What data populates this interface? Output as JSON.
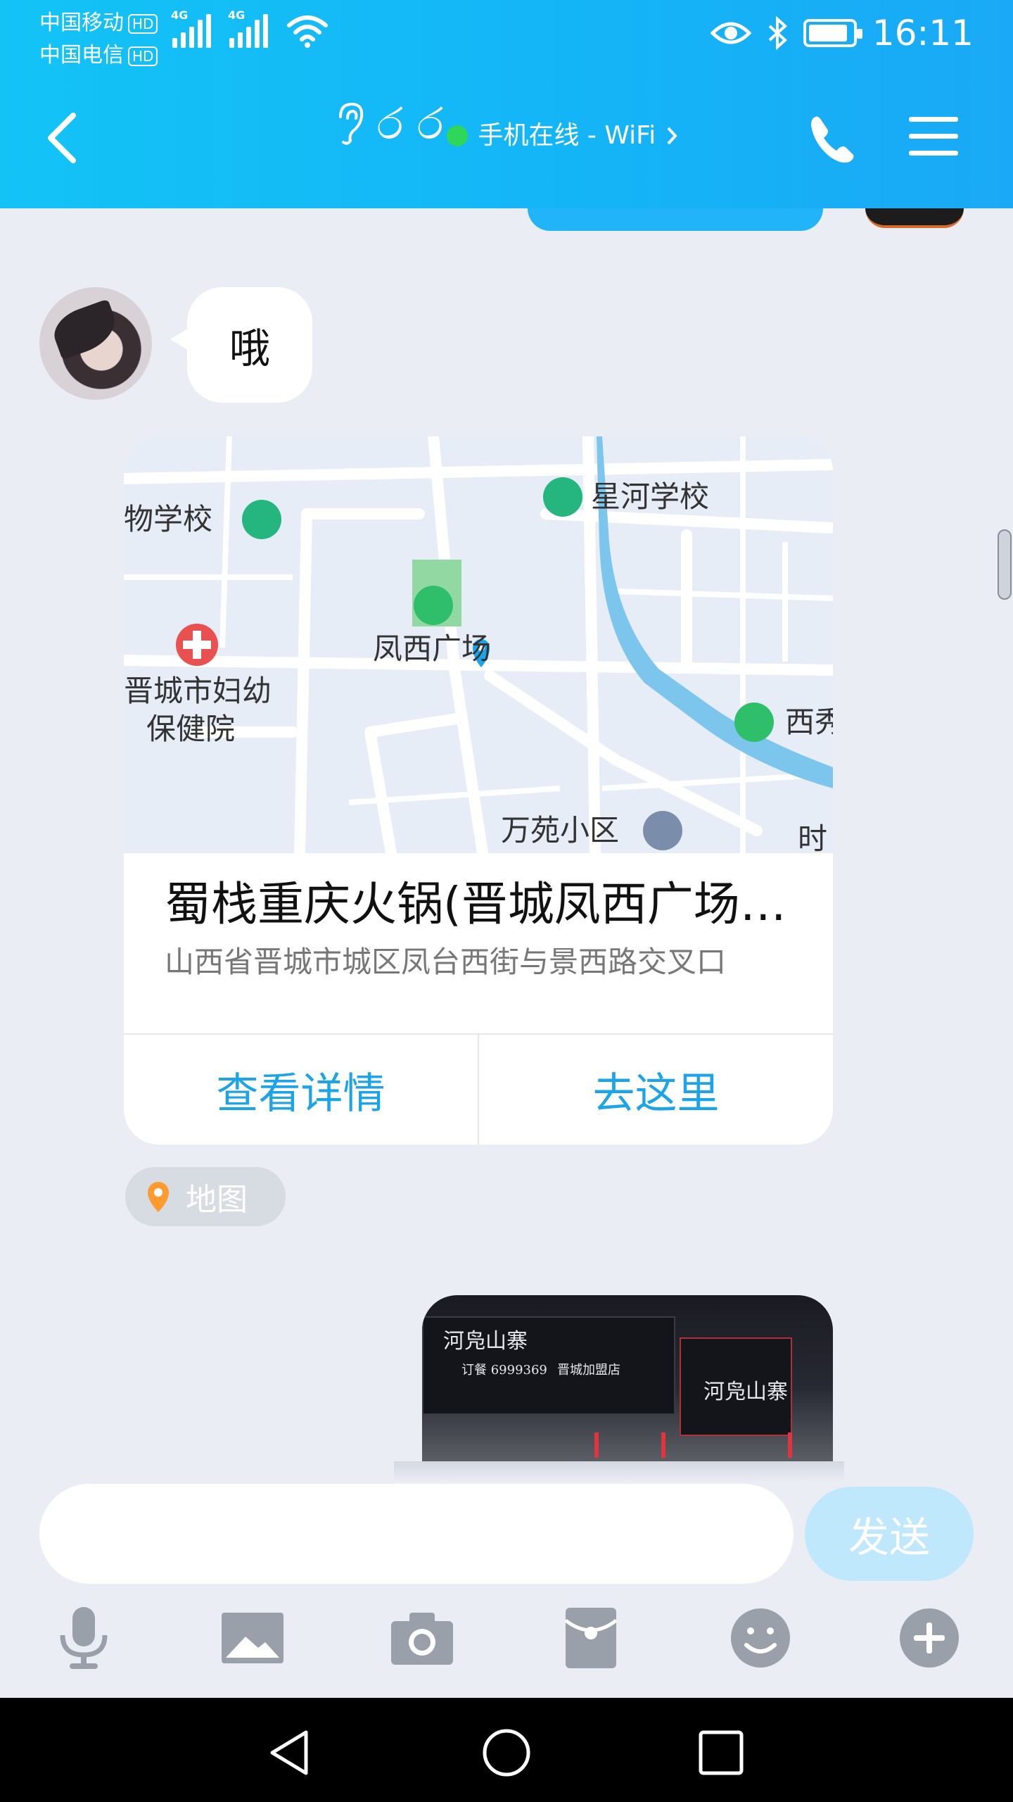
{
  "status_bar": {
    "carrier1": "中国移动",
    "carrier2": "中国电信",
    "hd_label": "HD",
    "network1": "4G",
    "network2": "4G",
    "time": "16:11"
  },
  "header": {
    "contact_name": "ර ර",
    "status_text": "手机在线 - WiFi",
    "status_color": "#2fd65a",
    "icons": [
      "back-icon",
      "ear-icon",
      "phone-icon",
      "menu-icon"
    ]
  },
  "messages": {
    "received_text": "哦",
    "location_card": {
      "title": "蜀栈重庆火锅(晋城凤西广场店)",
      "address": "山西省晋城市城区凤台西街与景西路交叉口",
      "details_button": "查看详情",
      "navigate_button": "去这里",
      "map_labels": {
        "school1": "物学校",
        "school2": "星河学校",
        "square": "凤西广场",
        "hospital_line1": "晋城市妇幼",
        "hospital_line2": "保健院",
        "park_partial": "西秀",
        "residential": "万苑小区",
        "edge_partial": "时"
      }
    },
    "map_tag": "地图",
    "photo_sign": {
      "name": "河凫山寨",
      "phone": "订餐 6999369",
      "branch": "晋城加盟店"
    }
  },
  "composer": {
    "input_value": "",
    "input_placeholder": "",
    "send_label": "发送"
  },
  "toolbar_icons": [
    "microphone-icon",
    "image-icon",
    "camera-icon",
    "red-packet-icon",
    "emoji-icon",
    "plus-icon"
  ],
  "colors": {
    "header": "#14b4f7",
    "accent": "#1ba4ea",
    "send_disabled": "#bfe8fc"
  }
}
